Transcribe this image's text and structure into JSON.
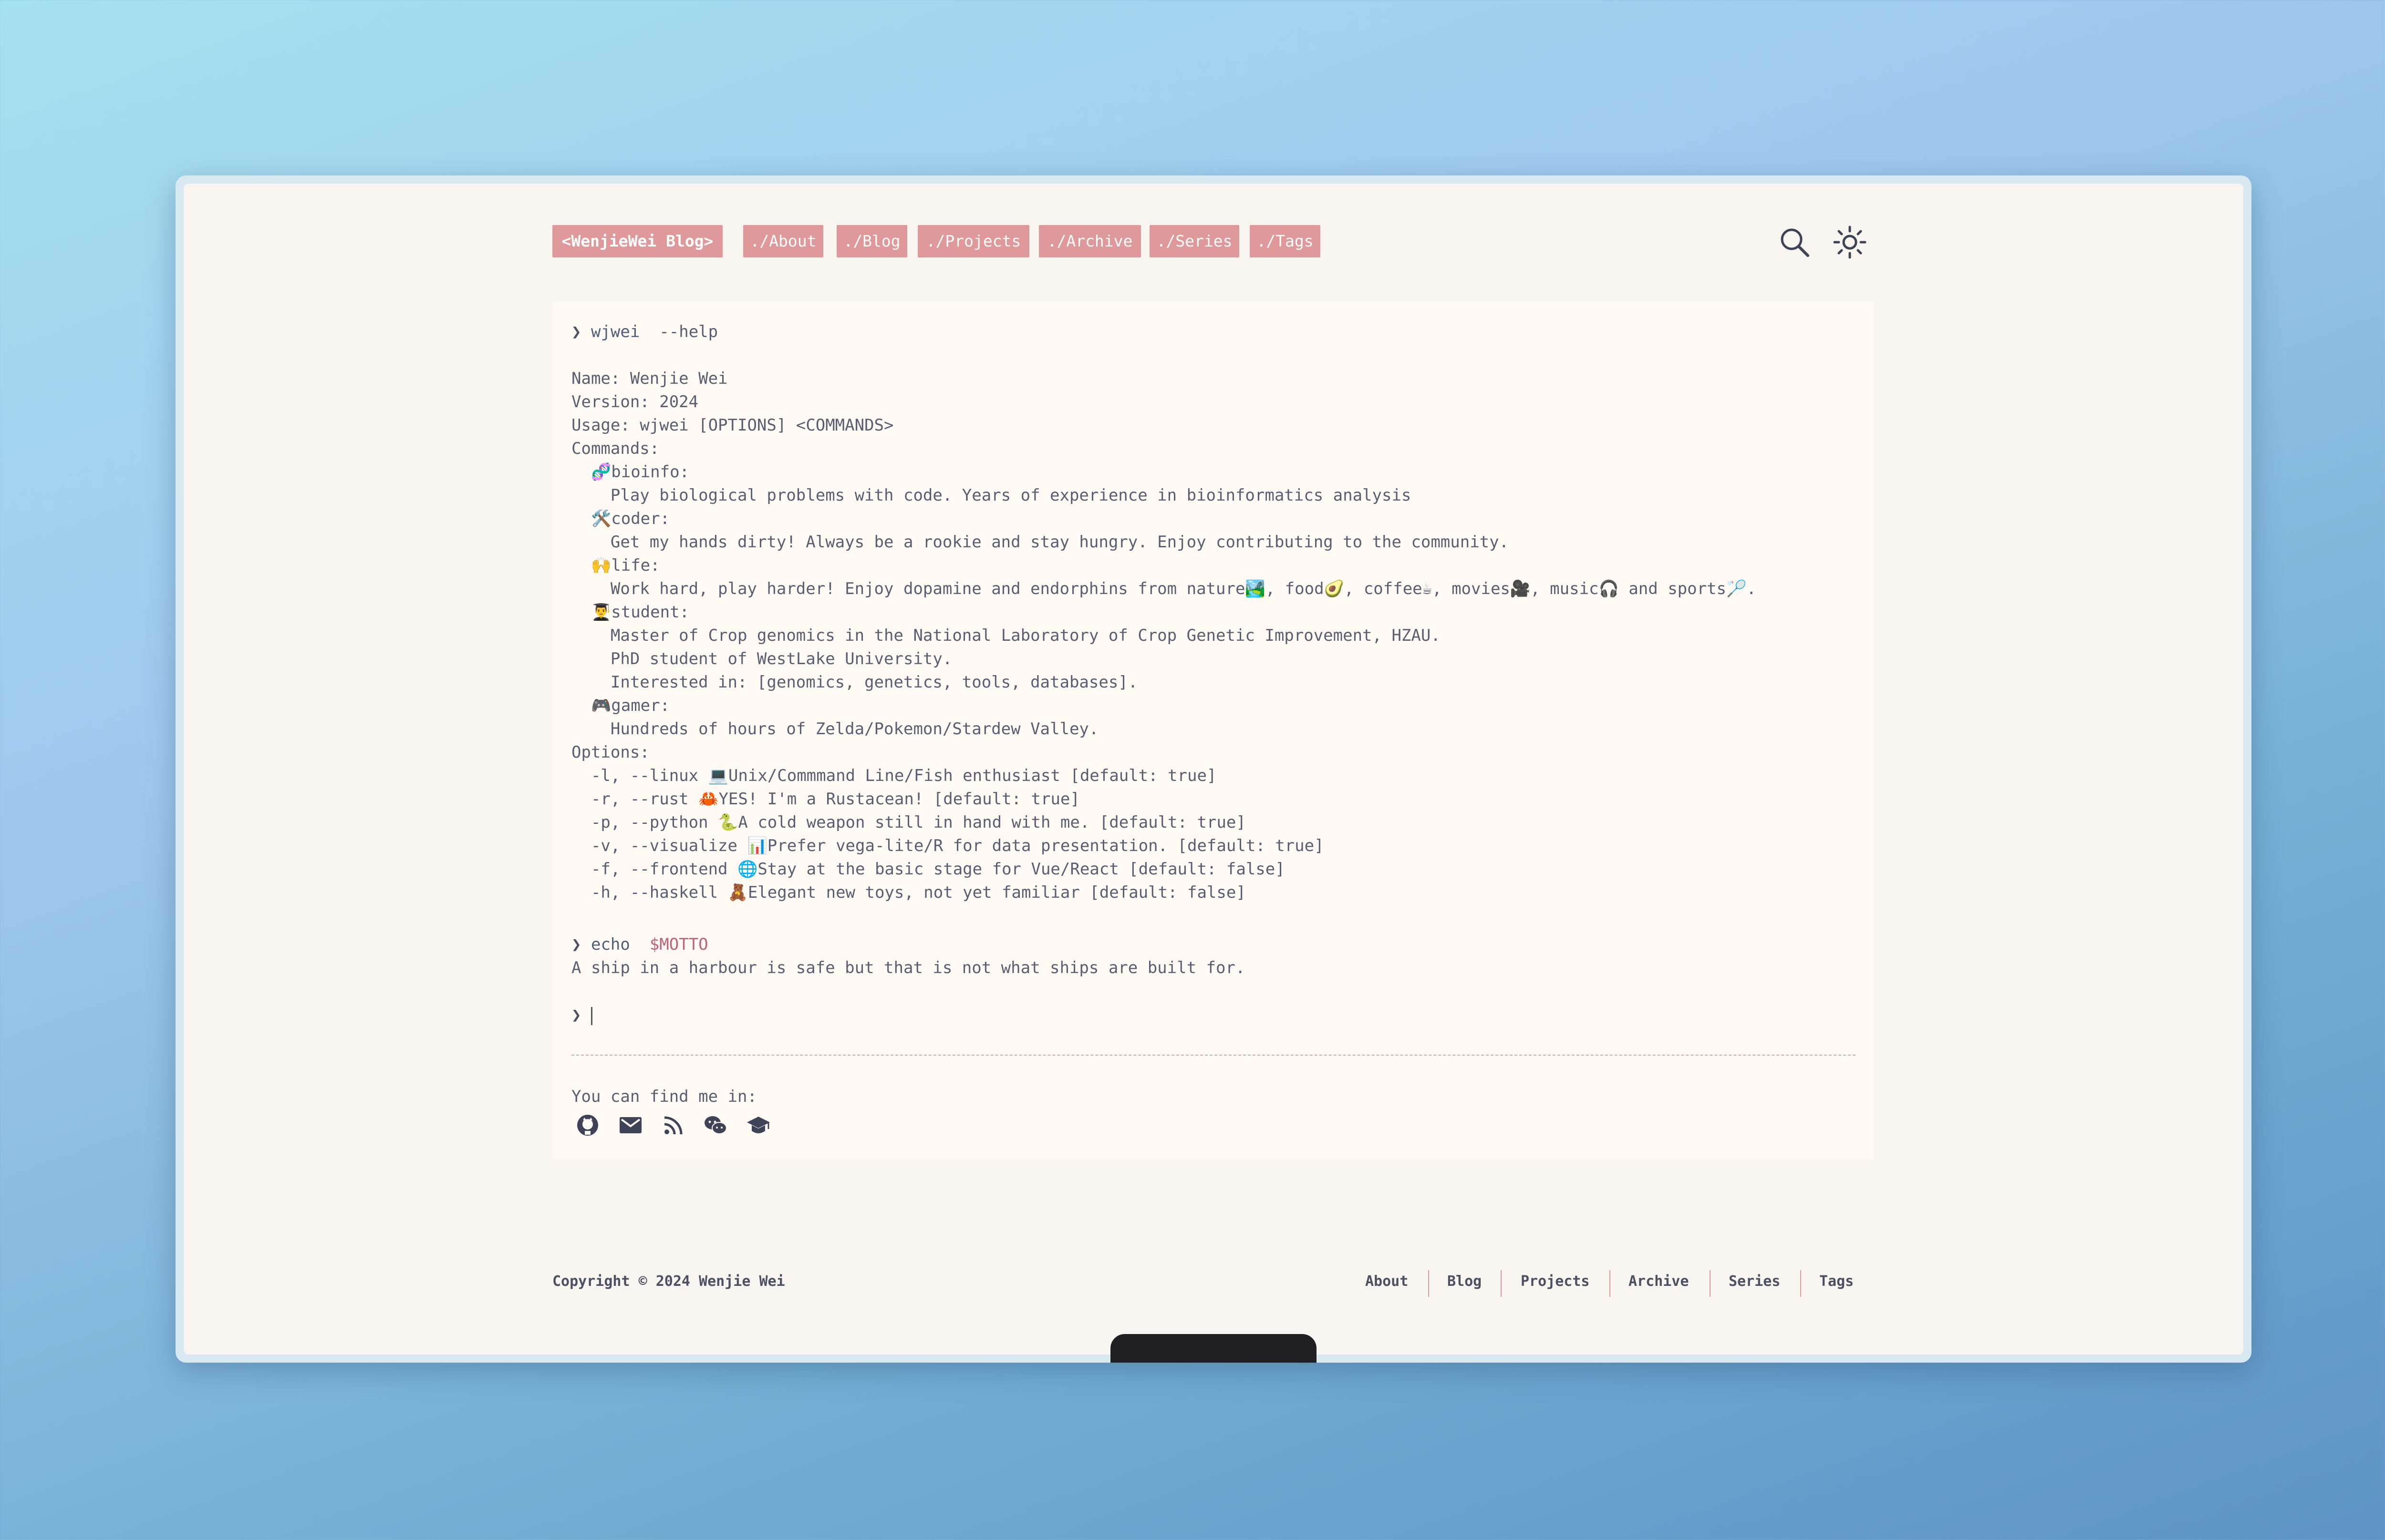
{
  "nav": {
    "brand": "<WenjieWei Blog>",
    "items": [
      "./About",
      "./Blog",
      "./Projects",
      "./Archive",
      "./Series",
      "./Tags"
    ]
  },
  "terminal": {
    "prompt_symbol": "❯",
    "cmd1": {
      "program": "wjwei",
      "args": "--help"
    },
    "lines": [
      "Name: Wenjie Wei",
      "Version: 2024",
      "Usage: wjwei [OPTIONS] <COMMANDS>",
      "Commands:",
      "  🧬bioinfo:",
      "    Play biological problems with code. Years of experience in bioinformatics analysis",
      "  🛠️coder:",
      "    Get my hands dirty! Always be a rookie and stay hungry. Enjoy contributing to the community.",
      "  🙌life:",
      "    Work hard, play harder! Enjoy dopamine and endorphins from nature🏞️, food🥑, coffee☕, movies🎥, music🎧 and sports🏸.",
      "  👨‍🎓student:",
      "    Master of Crop genomics in the National Laboratory of Crop Genetic Improvement, HZAU.",
      "    PhD student of WestLake University.",
      "    Interested in: [genomics, genetics, tools, databases].",
      "  🎮gamer:",
      "    Hundreds of hours of Zelda/Pokemon/Stardew Valley.",
      "Options:",
      "  -l, --linux 💻Unix/Commmand Line/Fish enthusiast [default: true]",
      "  -r, --rust 🦀YES! I'm a Rustacean! [default: true]",
      "  -p, --python 🐍A cold weapon still in hand with me. [default: true]",
      "  -v, --visualize 📊Prefer vega-lite/R for data presentation. [default: true]",
      "  -f, --frontend 🌐Stay at the basic stage for Vue/React [default: false]",
      "  -h, --haskell 🧸Elegant new toys, not yet familiar [default: false]"
    ],
    "cmd2": {
      "program": "echo",
      "var": "$MOTTO"
    },
    "motto": "A ship in a harbour is safe but that is not what ships are built for."
  },
  "social": {
    "label": "You can find me in:",
    "icons": [
      "github-icon",
      "email-icon",
      "rss-icon",
      "wechat-icon",
      "scholar-icon"
    ]
  },
  "footer": {
    "copyright": "Copyright © 2024 Wenjie Wei",
    "links": [
      "About",
      "Blog",
      "Projects",
      "Archive",
      "Series",
      "Tags"
    ]
  },
  "colors": {
    "accent": "#e0999a",
    "background": "#f8f4ef",
    "panel": "#fff9f3",
    "text": "#5a5e72",
    "variable": "#c0617c"
  }
}
